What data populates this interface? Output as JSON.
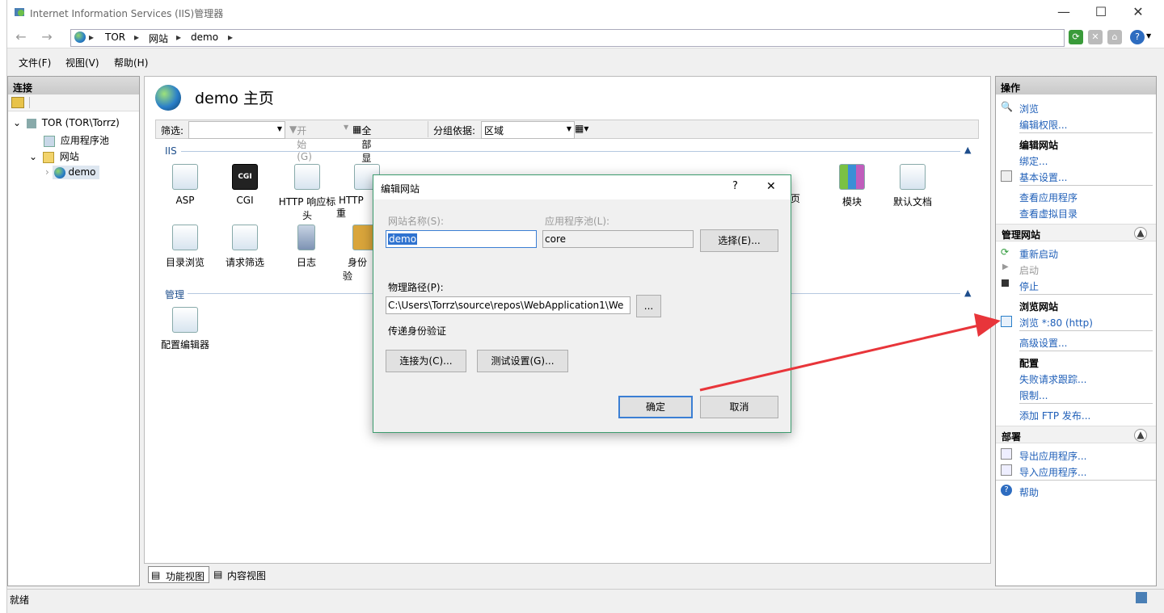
{
  "window": {
    "title": "Internet Information Services (IIS)管理器",
    "controls": {
      "minimize": "—",
      "maximize": "☐",
      "close": "✕"
    }
  },
  "address": {
    "crumbs": [
      "TOR",
      "网站",
      "demo"
    ],
    "separator": "▸"
  },
  "menu": [
    "文件(F)",
    "视图(V)",
    "帮助(H)"
  ],
  "connections": {
    "header": "连接",
    "tree": [
      {
        "label": "TOR (TOR\\Torrz)"
      },
      {
        "label": "应用程序池"
      },
      {
        "label": "网站"
      },
      {
        "label": "demo",
        "selected": true
      }
    ]
  },
  "main": {
    "title": "demo 主页",
    "toolbar": {
      "filter_label": "筛选:",
      "filter_value": "",
      "start_label": "开始(G)",
      "show_all_label": "全部显示(A)",
      "group_label": "分组依据:",
      "group_value": "区域"
    },
    "sections": [
      {
        "title": "IIS",
        "features": [
          "ASP",
          "CGI",
          "HTTP 响应标头",
          "HTTP 重",
          "",
          "",
          "",
          "",
          "",
          "",
          "页",
          "模块",
          "默认文档",
          "目录浏览",
          "请求筛选",
          "日志",
          "身份验"
        ]
      },
      {
        "title": "管理",
        "features": [
          "配置编辑器"
        ]
      }
    ]
  },
  "bottom_tabs": [
    "功能视图",
    "内容视图"
  ],
  "actions": {
    "header": "操作",
    "items": [
      {
        "label": "浏览",
        "type": "link"
      },
      {
        "label": "编辑权限...",
        "type": "link"
      },
      {
        "label": "编辑网站",
        "type": "heading"
      },
      {
        "label": "绑定...",
        "type": "link"
      },
      {
        "label": "基本设置...",
        "type": "link"
      },
      {
        "label": "查看应用程序",
        "type": "link"
      },
      {
        "label": "查看虚拟目录",
        "type": "link"
      },
      {
        "label": "管理网站",
        "type": "group"
      },
      {
        "label": "重新启动",
        "type": "link"
      },
      {
        "label": "启动",
        "type": "disabled"
      },
      {
        "label": "停止",
        "type": "link"
      },
      {
        "label": "浏览网站",
        "type": "heading"
      },
      {
        "label": "浏览 *:80 (http)",
        "type": "link"
      },
      {
        "label": "高级设置...",
        "type": "link"
      },
      {
        "label": "配置",
        "type": "heading"
      },
      {
        "label": "失败请求跟踪...",
        "type": "link"
      },
      {
        "label": "限制...",
        "type": "link"
      },
      {
        "label": "添加 FTP 发布...",
        "type": "link"
      },
      {
        "label": "部署",
        "type": "group"
      },
      {
        "label": "导出应用程序...",
        "type": "link"
      },
      {
        "label": "导入应用程序...",
        "type": "link"
      },
      {
        "label": "帮助",
        "type": "link"
      }
    ]
  },
  "dialog": {
    "title": "编辑网站",
    "help": "?",
    "close": "✕",
    "site_name_label": "网站名称(S):",
    "site_name_value": "demo",
    "app_pool_label": "应用程序池(L):",
    "app_pool_value": "core",
    "select_button": "选择(E)...",
    "physical_path_label": "物理路径(P):",
    "physical_path_value": "C:\\Users\\Torrz\\source\\repos\\WebApplication1\\We",
    "browse_button": "...",
    "pass_through_label": "传递身份验证",
    "connect_as_button": "连接为(C)...",
    "test_settings_button": "测试设置(G)...",
    "ok_button": "确定",
    "cancel_button": "取消"
  },
  "status": "就绪",
  "colors": {
    "link": "#1f5fb8",
    "dialog_border": "#3c9c6e",
    "annotation_arrow": "#e8353a"
  }
}
